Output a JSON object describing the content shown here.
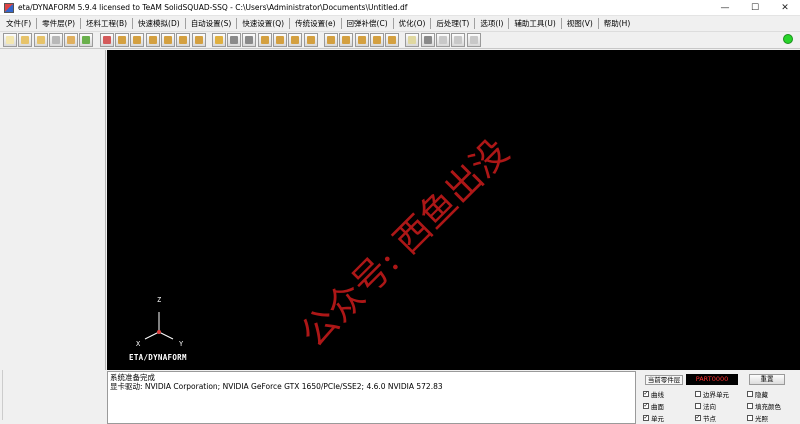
{
  "window": {
    "title": "eta/DYNAFORM 5.9.4 licensed to TeAM SolidSQUAD-SSQ - C:\\Users\\Administrator\\Documents\\Untitled.df",
    "minimize": "—",
    "maximize": "☐",
    "close": "✕"
  },
  "menu": [
    "文件(F)",
    "零件层(P)",
    "坯料工程(B)",
    "快速模拟(D)",
    "自动设置(S)",
    "快速设置(Q)",
    "传统设置(e)",
    "回弹补偿(C)",
    "优化(O)",
    "后处理(T)",
    "选项(I)",
    "辅助工具(U)",
    "视图(V)",
    "帮助(H)"
  ],
  "toolbar": {
    "colors": [
      "#f4e7b0",
      "#e7c36a",
      "#e7c36a",
      "#b8b8b8",
      "#e0b060",
      "#6ab04c",
      "#d45a5a",
      "#d4a040",
      "#d4a040",
      "#d4a040",
      "#d4a040",
      "#d4a040",
      "#d4a040",
      "#e0b040",
      "#8a8a8a",
      "#8a8a8a",
      "#d4a040",
      "#d4a040",
      "#d4a040",
      "#d4a040",
      "#d4a040",
      "#d4a040",
      "#d4a040",
      "#d4a040",
      "#d4a040",
      "#e0d8a0",
      "#8a8a8a",
      "#c8c8c8",
      "#c8c8c8",
      "#c8c8c8"
    ],
    "status_color": "#27d42a"
  },
  "viewport": {
    "triad": {
      "z": "Z",
      "x": "X",
      "y": "Y"
    },
    "brand": "ETA/DYNAFORM",
    "watermark": "公众号: 西鱼出没"
  },
  "messages": [
    "系统准备完成",
    "显卡驱动: NVIDIA Corporation; NVIDIA GeForce GTX 1650/PCIe/SSE2; 4.6.0 NVIDIA 572.83"
  ],
  "control_panel": {
    "current_part_label": "当前零件层",
    "current_part_value": "PART0000",
    "reset_label": "重置",
    "checkboxes": [
      {
        "label": "曲线",
        "checked": true
      },
      {
        "label": "边界单元",
        "checked": false
      },
      {
        "label": "隐藏",
        "checked": false
      },
      {
        "label": "曲面",
        "checked": true
      },
      {
        "label": "法向",
        "checked": false
      },
      {
        "label": "填充颜色",
        "checked": false
      },
      {
        "label": "单元",
        "checked": true
      },
      {
        "label": "节点",
        "checked": true
      },
      {
        "label": "光照",
        "checked": false
      }
    ]
  }
}
